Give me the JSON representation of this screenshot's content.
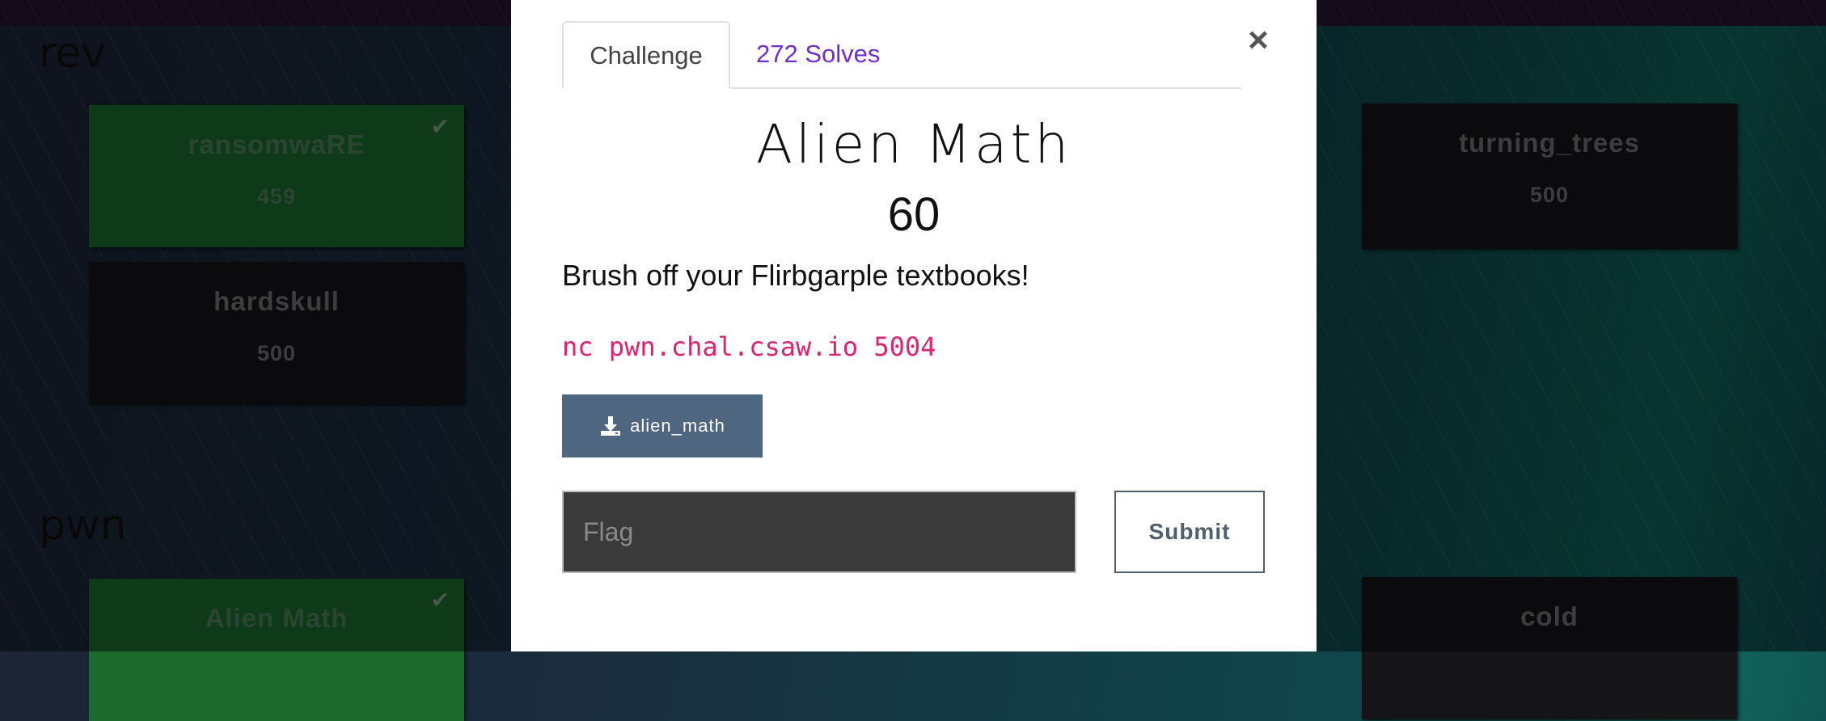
{
  "categories": [
    {
      "name": "rev",
      "challenges": [
        {
          "name": "ransomwaRE",
          "points": "459",
          "solved": true
        },
        {
          "name": "hardskull",
          "points": "500",
          "solved": false
        },
        {
          "name": "turning_trees",
          "points": "500",
          "solved": false
        }
      ]
    },
    {
      "name": "pwn",
      "challenges": [
        {
          "name": "Alien Math",
          "points": "",
          "solved": true
        },
        {
          "name": "cold",
          "points": "",
          "solved": false
        }
      ]
    }
  ],
  "modal": {
    "tabs": [
      {
        "label": "Challenge",
        "active": true
      },
      {
        "label": "272 Solves",
        "active": false
      }
    ],
    "close_label": "×",
    "title": "Alien Math",
    "value": "60",
    "description": "Brush off your Flirbgarple textbooks!",
    "command": "nc pwn.chal.csaw.io 5004",
    "file_label": "alien_math",
    "flag_placeholder": "Flag",
    "flag_value": "",
    "submit_label": "Submit"
  },
  "colors": {
    "solved": "#1d6a2f",
    "unsolved": "#151518",
    "accent_purple": "#6f2dd6",
    "command_pink": "#e0216e",
    "file_button": "#4f6680"
  },
  "icons": {
    "solved_check": "check-icon",
    "download": "download-icon"
  }
}
